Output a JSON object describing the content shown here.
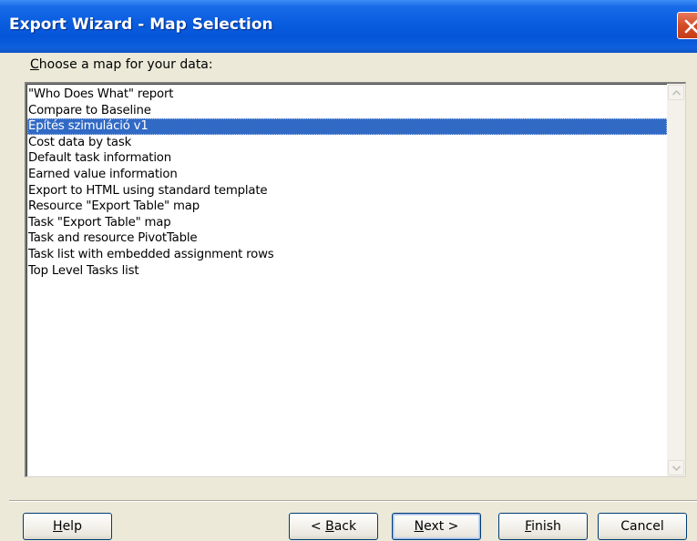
{
  "window": {
    "title": "Export Wizard - Map Selection"
  },
  "prompt": {
    "mnemonic": "C",
    "rest": "hoose a map for your data:"
  },
  "maps": [
    {
      "label": "\"Who Does What\" report",
      "selected": false
    },
    {
      "label": "Compare to Baseline",
      "selected": false
    },
    {
      "label": "Építés szimuláció v1",
      "selected": true
    },
    {
      "label": "Cost data by task",
      "selected": false
    },
    {
      "label": "Default task information",
      "selected": false
    },
    {
      "label": "Earned value information",
      "selected": false
    },
    {
      "label": "Export to HTML using standard template",
      "selected": false
    },
    {
      "label": "Resource \"Export Table\" map",
      "selected": false
    },
    {
      "label": "Task \"Export Table\" map",
      "selected": false
    },
    {
      "label": "Task and resource PivotTable",
      "selected": false
    },
    {
      "label": "Task list with embedded assignment rows",
      "selected": false
    },
    {
      "label": "Top Level Tasks list",
      "selected": false
    }
  ],
  "buttons": {
    "help": {
      "mnemonic": "H",
      "rest": "elp"
    },
    "back": {
      "prefix": "< ",
      "mnemonic": "B",
      "rest": "ack"
    },
    "next": {
      "mnemonic": "N",
      "rest": "ext >"
    },
    "finish": {
      "mnemonic": "F",
      "rest": "inish"
    },
    "cancel": {
      "label": "Cancel"
    }
  },
  "colors": {
    "titlebar": "#0a5ee0",
    "selection": "#316ac5",
    "dialog_bg": "#ece9d8"
  }
}
